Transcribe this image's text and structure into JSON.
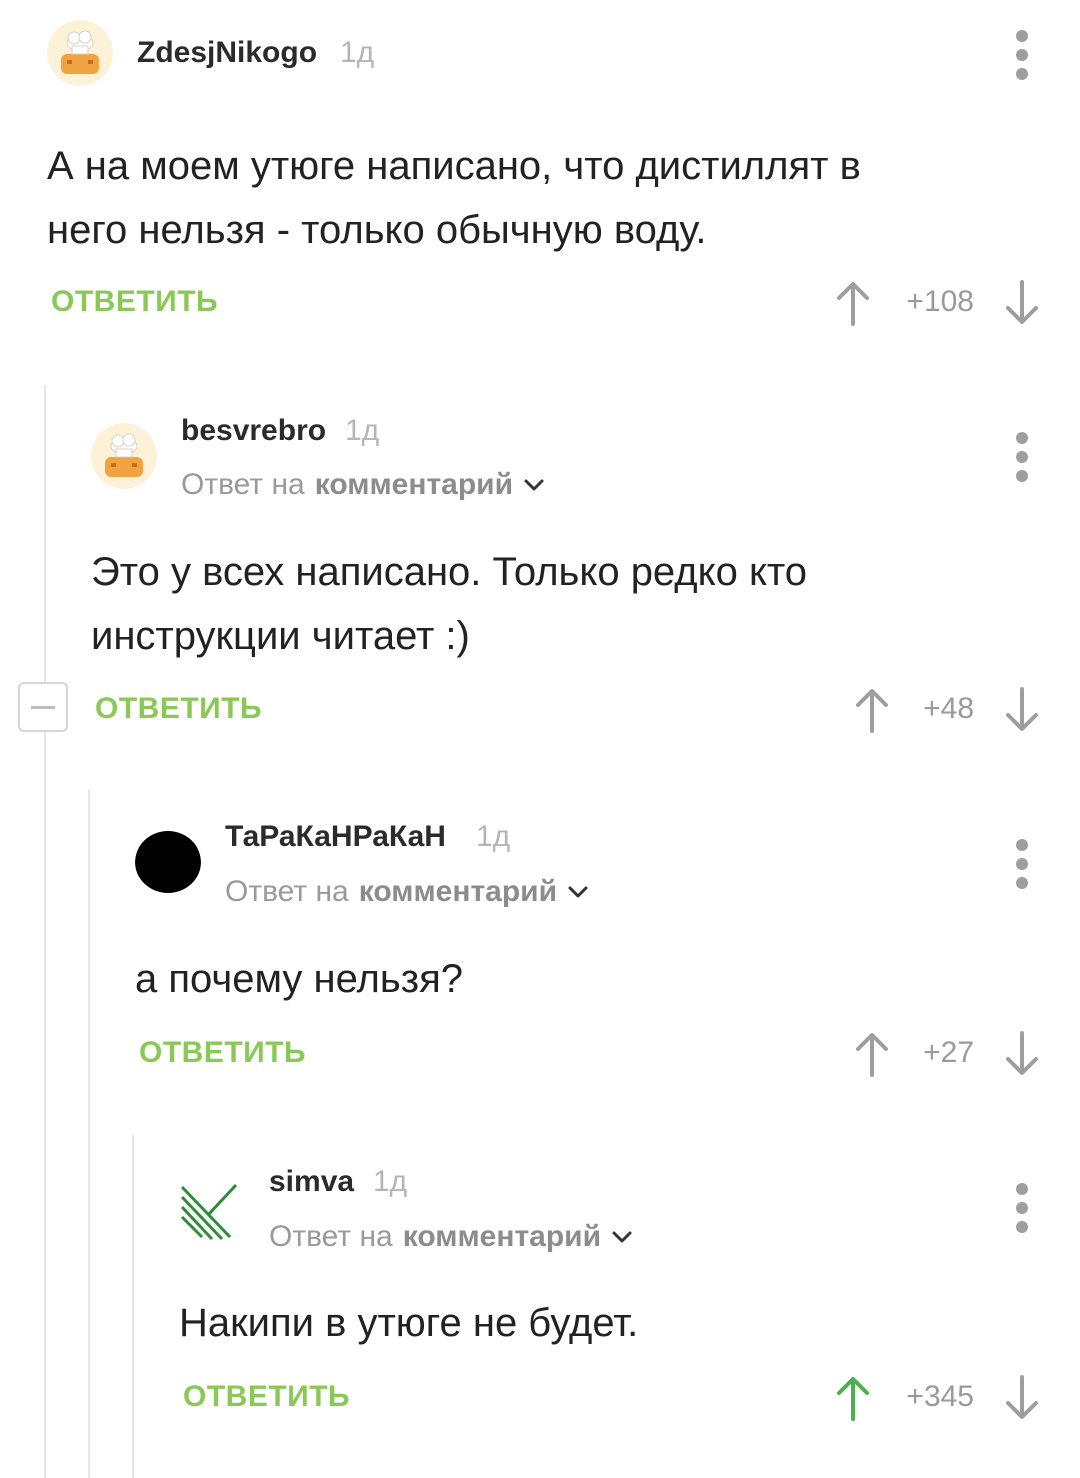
{
  "colors": {
    "accent": "#8ac858",
    "upvoted": "#4caf50",
    "muted": "#9a9a9a"
  },
  "comments": [
    {
      "username": "ZdesjNikogo",
      "time": "1д",
      "avatar": "chef-hat-avatar",
      "text_lines": [
        "А на моем утюге написано, что дистиллят в",
        "него нельзя - только обычную воду."
      ],
      "reply_label": "ОТВЕТИТЬ",
      "score": "+108"
    },
    {
      "username": "besvrebro",
      "time": "1д",
      "avatar": "chef-hat-avatar",
      "reply_to_prefix": "Ответ на",
      "reply_to_link": "комментарий",
      "text_lines": [
        "Это у всех написано. Только редко кто",
        "инструкции читает :)"
      ],
      "reply_label": "ОТВЕТИТЬ",
      "score": "+48"
    },
    {
      "username": "ТаРаКаНРаКаН",
      "time": "1д",
      "avatar": "black-circle-avatar",
      "reply_to_prefix": "Ответ на",
      "reply_to_link": "комментарий",
      "text_lines": [
        "а почему нельзя?"
      ],
      "reply_label": "ОТВЕТИТЬ",
      "score": "+27"
    },
    {
      "username": "simva",
      "time": "1д",
      "avatar": "green-stripes-avatar",
      "reply_to_prefix": "Ответ на",
      "reply_to_link": "комментарий",
      "text_lines": [
        "Накипи в утюге не будет."
      ],
      "reply_label": "ОТВЕТИТЬ",
      "score": "+345",
      "upvoted": true
    }
  ]
}
